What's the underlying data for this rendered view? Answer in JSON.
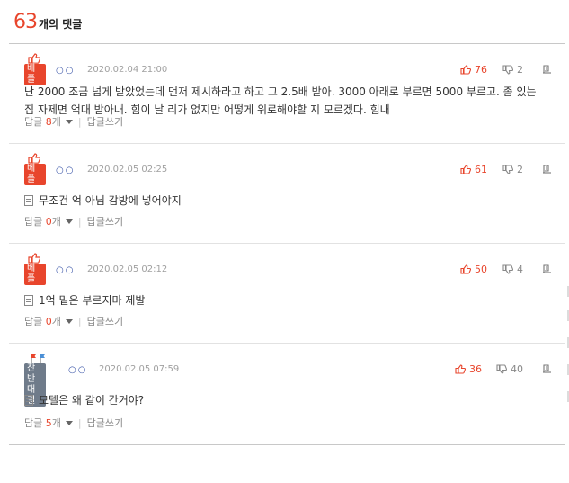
{
  "header": {
    "count": "63",
    "label": "개의 댓글"
  },
  "comments": [
    {
      "badge": "베플",
      "nick": "○○",
      "date": "2020.02.04 21:00",
      "likes": "76",
      "dislikes": "2",
      "text": "난 2000 조금 넘게 받았었는데 먼저 제시하라고 하고 그 2.5배 받아. 3000 아래로 부르면 5000 부르고. 좀 있는 집 자제면 억대 받아내. 힘이 날 리가 없지만 어떻게 위로해야할 지 모르겠다. 힘내",
      "reply_label": "답글",
      "reply_count": "8",
      "reply_unit": "개",
      "write_label": "답글쓰기"
    },
    {
      "badge": "베플",
      "nick": "○○",
      "date": "2020.02.05 02:25",
      "likes": "61",
      "dislikes": "2",
      "text": "무조건 억 아님 감방에 넣어야지",
      "reply_label": "답글",
      "reply_count": "0",
      "reply_unit": "개",
      "write_label": "답글쓰기"
    },
    {
      "badge": "베플",
      "nick": "○○",
      "date": "2020.02.05 02:12",
      "likes": "50",
      "dislikes": "4",
      "text": "1억 밑은 부르지마 제발",
      "reply_label": "답글",
      "reply_count": "0",
      "reply_unit": "개",
      "write_label": "답글쓰기"
    },
    {
      "badge": "찬반대결",
      "nick": "○○",
      "date": "2020.02.05 07:59",
      "likes": "36",
      "dislikes": "40",
      "text": "모텔은 왜 같이 간거야?",
      "reply_label": "답글",
      "reply_count": "5",
      "reply_unit": "개",
      "write_label": "답글쓰기"
    }
  ],
  "colors": {
    "accent": "#e8452c",
    "nick": "#3a55a8",
    "muted": "#a0a0a0",
    "badge_gray": "#6f7b8a"
  },
  "icons": {
    "like": "thumbs-up-icon",
    "dislike": "thumbs-down-icon",
    "report": "report-icon",
    "best": "best-thumb-icon",
    "versus": "versus-flag-icon",
    "text": "document-icon"
  }
}
